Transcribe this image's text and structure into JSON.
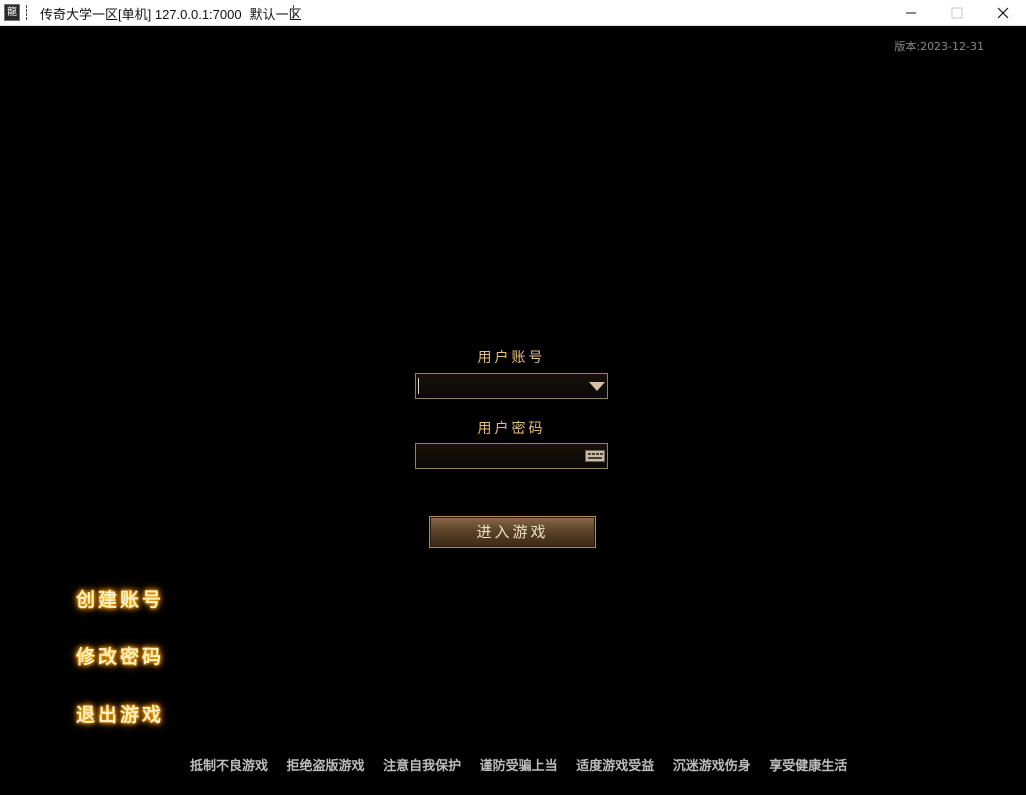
{
  "window": {
    "app_icon": "app-logo-icon",
    "icon_glyph": "龍",
    "title": "传奇大学一区[单机] 127.0.0.1:7000",
    "server": "默认一区",
    "controls": [
      "minimize-icon",
      "maximize-icon",
      "close-icon"
    ]
  },
  "version_text": "版本:2023-12-31",
  "login": {
    "account_label": "用户账号",
    "account_value": "",
    "password_label": "用户密码",
    "password_value": "",
    "enter_label": "进入游戏"
  },
  "side_menu": {
    "create_account": "创建账号",
    "change_password": "修改密码",
    "exit_game": "退出游戏"
  },
  "footer_notices": [
    "抵制不良游戏",
    "拒绝盗版游戏",
    "注意自我保护",
    "谨防受骗上当",
    "适度游戏受益",
    "沉迷游戏伤身",
    "享受健康生活"
  ],
  "colors": {
    "background": "#000000",
    "label_gold": "#e7c07a",
    "glow": "#ffb300",
    "footer_text": "#bdbdbd"
  }
}
